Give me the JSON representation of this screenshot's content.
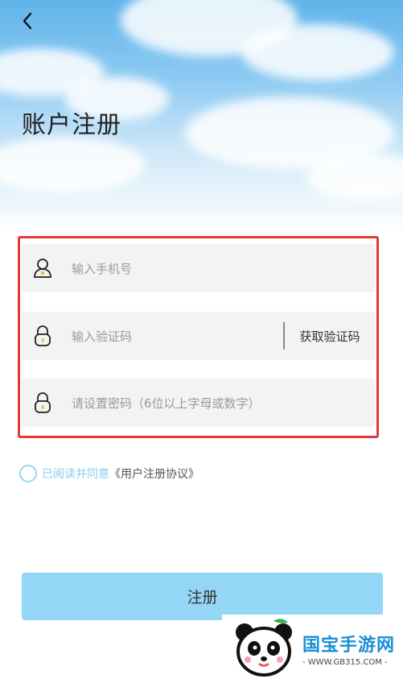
{
  "header": {
    "title": "账户注册"
  },
  "form": {
    "phone_placeholder": "输入手机号",
    "code_placeholder": "输入验证码",
    "get_code_label": "获取验证码",
    "password_placeholder": "请设置密码（6位以上字母或数字）"
  },
  "agreement": {
    "text": "已阅读并同意",
    "link": "《用户注册协议》"
  },
  "actions": {
    "register_label": "注册"
  },
  "watermark": {
    "brand": "国宝手游网",
    "url": "- WWW.GB315.COM -"
  },
  "colors": {
    "accent": "#93d6f5",
    "highlight_border": "#e23a3a"
  }
}
